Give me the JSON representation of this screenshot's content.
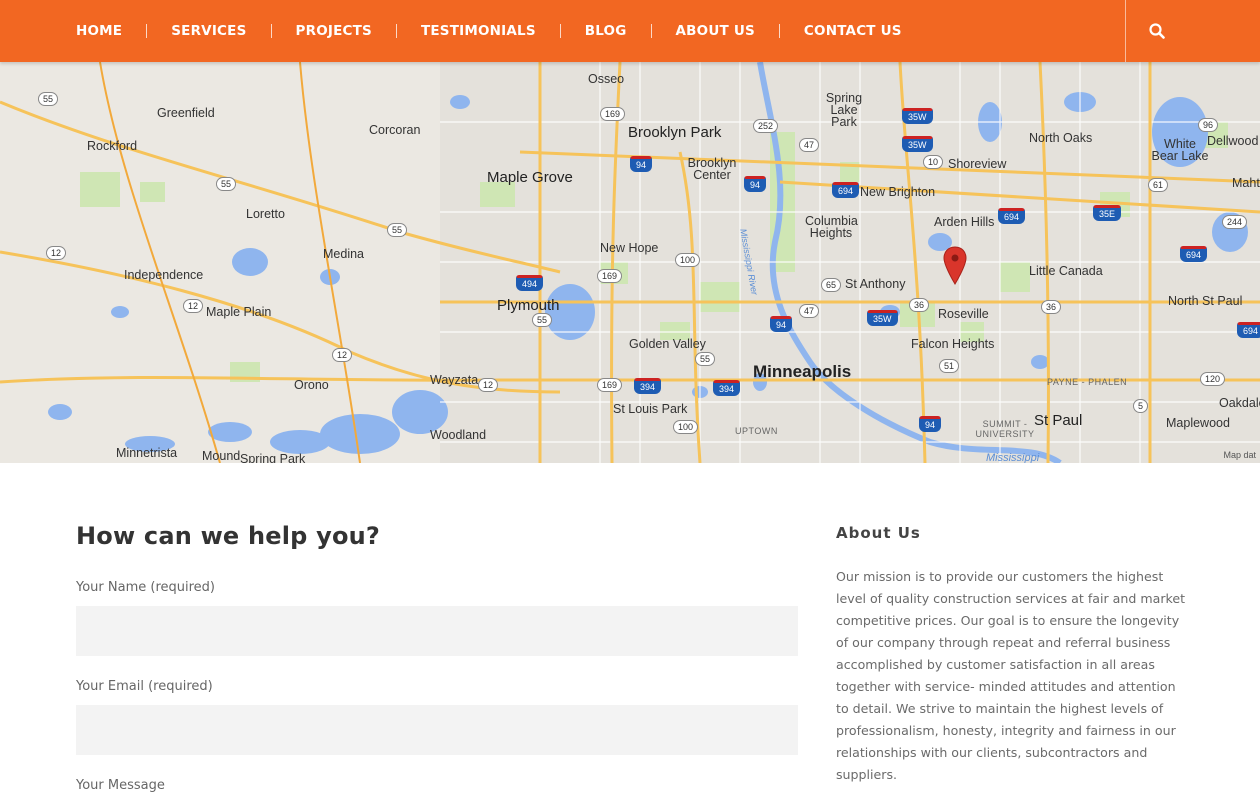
{
  "nav": {
    "items": [
      {
        "label": "HOME"
      },
      {
        "label": "SERVICES"
      },
      {
        "label": "PROJECTS"
      },
      {
        "label": "TESTIMONIALS"
      },
      {
        "label": "BLOG"
      },
      {
        "label": "ABOUT US"
      },
      {
        "label": "CONTACT US"
      }
    ],
    "search_icon": "search-icon",
    "accent_color": "#f26722"
  },
  "map": {
    "labels": {
      "greenfield": "Greenfield",
      "rockford": "Rockford",
      "corcoran": "Corcoran",
      "osseo": "Osseo",
      "brooklyn_park": "Brooklyn Park",
      "brooklyn_center": "Brooklyn Center",
      "maple_grove": "Maple Grove",
      "loretto": "Loretto",
      "medina": "Medina",
      "independence": "Independence",
      "new_hope": "New Hope",
      "plymouth": "Plymouth",
      "maple_plain": "Maple Plain",
      "orono": "Orono",
      "wayzata": "Wayzata",
      "golden_valley": "Golden Valley",
      "st_louis_park": "St Louis Park",
      "woodland": "Woodland",
      "minnetrista": "Minnetrista",
      "mound": "Mound",
      "spring_park": "Spring Park",
      "minneapolis": "Minneapolis",
      "uptown": "UPTOWN",
      "spring_lake_park": "Spring Lake Park",
      "shoreview": "Shoreview",
      "new_brighton": "New Brighton",
      "columbia_heights": "Columbia Heights",
      "arden_hills": "Arden Hills",
      "st_anthony": "St Anthony",
      "roseville": "Roseville",
      "falcon_heights": "Falcon Heights",
      "st_paul": "St Paul",
      "summit_university": "SUMMIT - UNIVERSITY",
      "payne_phalen": "PAYNE - PHALEN",
      "north_oaks": "North Oaks",
      "white_bear_lake": "White Bear Lake",
      "dellwood": "Dellwood",
      "mahto": "Mahto",
      "little_canada": "Little Canada",
      "north_st_paul": "North St Paul",
      "maplewood": "Maplewood",
      "oakdale": "Oakdale",
      "mississippi_river": "Mississippi River",
      "mississippi": "Mississippi",
      "credit": "Map dat"
    },
    "marker_icon": "map-pin-icon",
    "marker_color": "#d9352b"
  },
  "form": {
    "heading": "How can we help you?",
    "name_label": "Your Name (required)",
    "email_label": "Your Email (required)",
    "message_label": "Your Message",
    "name_value": "",
    "email_value": ""
  },
  "about": {
    "title": "About Us",
    "text": "Our mission is to provide our customers the highest level of quality construction services at fair and market competitive prices. Our goal is to ensure the longevity of our company through repeat and referral business accomplished by customer satisfaction in all areas together with service- minded attitudes and attention to detail. We strive to maintain the highest levels of professionalism, honesty, integrity and fairness in our relationships with our clients, subcontractors and suppliers."
  }
}
